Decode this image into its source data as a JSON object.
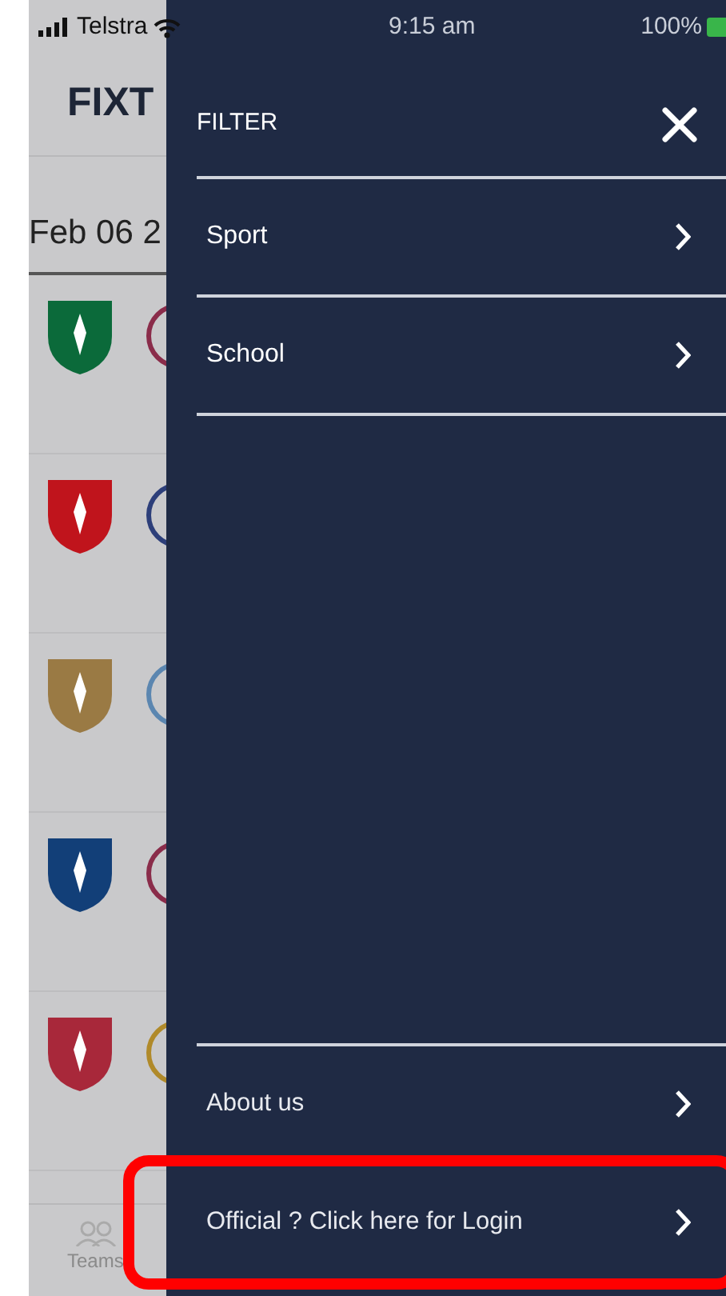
{
  "status_bar": {
    "carrier": "Telstra",
    "time": "9:15 am",
    "battery": "100%"
  },
  "page": {
    "title": "FIXT",
    "date": "Feb 06 2",
    "tab_bar": [
      {
        "label": "Teams"
      }
    ]
  },
  "drawer": {
    "title": "FILTER",
    "filters": [
      {
        "label": "Sport"
      },
      {
        "label": "School"
      }
    ],
    "footer": [
      {
        "label": "About us",
        "highlighted": false
      },
      {
        "label": "Official ? Click here for Login",
        "highlighted": true
      }
    ]
  }
}
